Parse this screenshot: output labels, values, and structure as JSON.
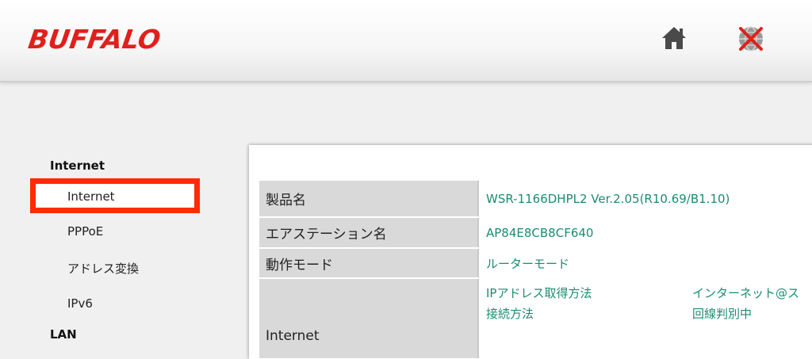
{
  "brand": {
    "name": "BUFFALO",
    "color": "#e0201b"
  },
  "header_icons": {
    "home": "home-icon",
    "status": "globe-disconnected-icon"
  },
  "sidebar": {
    "groups": [
      {
        "label": "Internet",
        "items": [
          "Internet",
          "PPPoE",
          "アドレス変換",
          "IPv6"
        ]
      },
      {
        "label": "LAN"
      }
    ],
    "highlighted_item": "Internet",
    "highlight_color": "#ff2a00"
  },
  "status_table": {
    "rows": [
      {
        "label": "製品名",
        "value": "WSR-1166DHPL2 Ver.2.05(R10.69/B1.10)"
      },
      {
        "label": "エアステーション名",
        "value": "AP84E8CB8CF640"
      },
      {
        "label": "動作モード",
        "value": "ルーターモード"
      },
      {
        "label": "Internet",
        "sub": [
          {
            "key": "IPアドレス取得方法",
            "value": "インターネット@ス"
          },
          {
            "key": "接続方法",
            "value": "回線判別中"
          }
        ]
      }
    ],
    "value_color": "#1c8c70"
  }
}
